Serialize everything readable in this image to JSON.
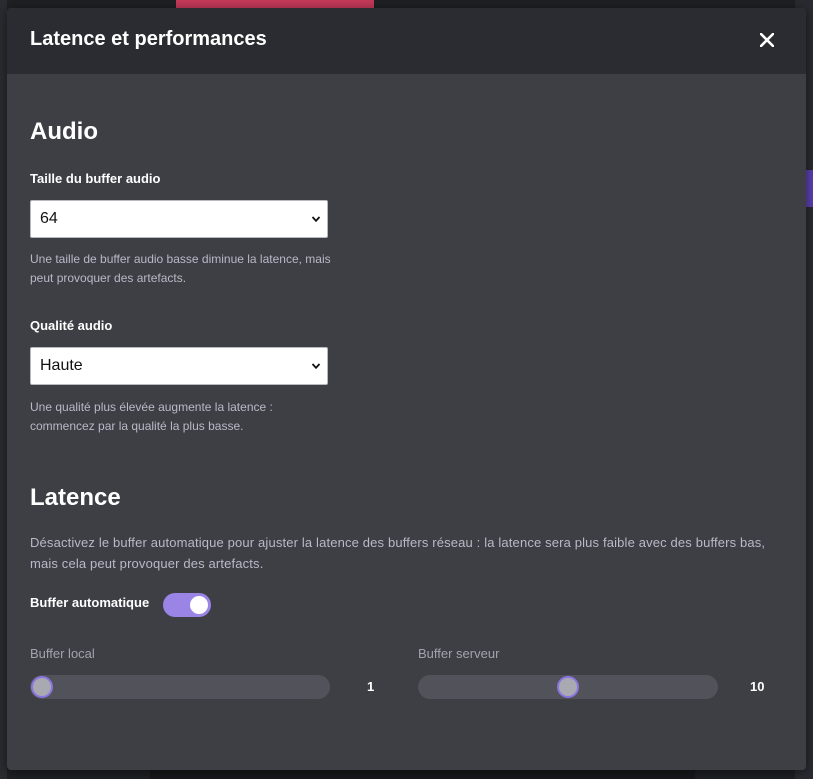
{
  "dialog": {
    "title": "Latence et performances",
    "close_icon": "close-icon"
  },
  "audio": {
    "heading": "Audio",
    "buffer_size": {
      "label": "Taille du buffer audio",
      "value": "64",
      "help": "Une taille de buffer audio basse diminue la latence, mais peut provoquer des artefacts."
    },
    "quality": {
      "label": "Qualité audio",
      "value": "Haute",
      "help": "Une qualité plus élevée augmente la latence : commencez par la qualité la plus basse."
    }
  },
  "latency": {
    "heading": "Latence",
    "description": "Désactivez le buffer automatique pour ajuster la latence des buffers réseau : la latence sera plus faible avec des buffers bas, mais cela peut provoquer des artefacts.",
    "auto_buffer": {
      "label": "Buffer automatique",
      "enabled": true
    },
    "local_buffer": {
      "label": "Buffer local",
      "value": "1",
      "fraction": 0.0
    },
    "server_buffer": {
      "label": "Buffer serveur",
      "value": "10",
      "fraction": 0.5
    }
  },
  "colors": {
    "accent": "#9a85e6",
    "dialog_bg": "#3e3f45",
    "header_bg": "#2b2c31"
  }
}
